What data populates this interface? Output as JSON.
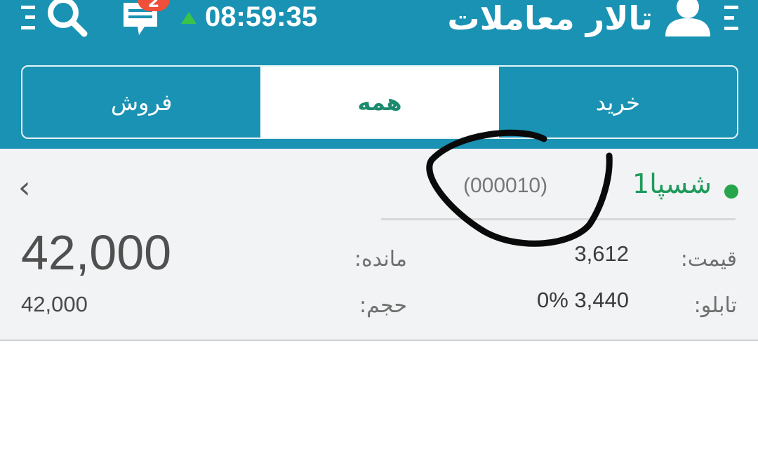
{
  "header": {
    "title": "تالار معاملات",
    "clock": "08:59:35",
    "message_badge": "2"
  },
  "tabs": [
    {
      "label": "خرید",
      "active": false
    },
    {
      "label": "همه",
      "active": true
    },
    {
      "label": "فروش",
      "active": false
    }
  ],
  "order": {
    "symbol": "شسپا1",
    "code": "(000010)",
    "price_label": "قیمت:",
    "price_value": "3,612",
    "board_label": "تابلو:",
    "board_value": "0% 3,440",
    "remaining_label": "مانده:",
    "remaining_value": "42,000",
    "volume_label": "حجم:",
    "volume_value": "42,000"
  },
  "colors": {
    "header": "#1a92b3",
    "active_tab_text": "#1b8a6e",
    "symbol_green": "#1f9a5c",
    "status_green": "#3ac34a",
    "badge_red": "#f0503a"
  },
  "icons": [
    "menu-icon",
    "search-icon",
    "message-icon",
    "user-profile-icon",
    "chevron-left-icon"
  ]
}
